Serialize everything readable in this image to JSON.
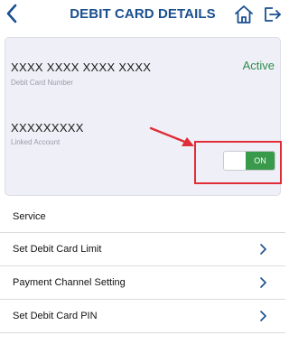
{
  "header": {
    "title": "DEBIT CARD DETAILS",
    "back_icon": "chevron-left-icon",
    "home_icon": "home-icon",
    "logout_icon": "logout-icon",
    "accent_color": "#1a4f8f"
  },
  "card": {
    "number": "XXXX XXXX XXXX XXXX",
    "number_label": "Debit Card Number",
    "status": "Active",
    "status_color": "#2e8b4a",
    "linked_account": "XXXXXXXXX",
    "linked_account_label": "Linked Account",
    "toggle": {
      "state_label": "ON",
      "on": true,
      "color": "#3a9a4c"
    },
    "highlight_color": "#e02d38"
  },
  "menu": {
    "section_title": "Service",
    "items": [
      {
        "label": "Set Debit Card Limit",
        "icon": "chevron-right-icon"
      },
      {
        "label": "Payment Channel Setting",
        "icon": "chevron-right-icon"
      },
      {
        "label": "Set Debit Card PIN",
        "icon": "chevron-right-icon"
      }
    ]
  }
}
